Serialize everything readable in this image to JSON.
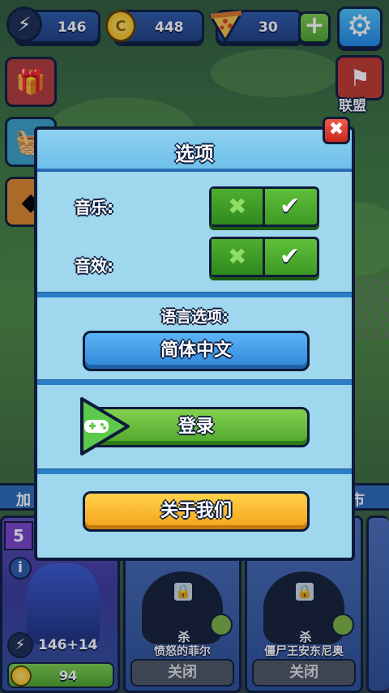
{
  "hud": {
    "energy": "146",
    "coins": "448",
    "pizza": "30",
    "energy_icon": "lightning-icon",
    "coin_icon": "coin-icon",
    "pizza_icon": "pizza-icon",
    "plus_label": "+",
    "settings_icon": "gear-icon"
  },
  "side": {
    "league_label": "联盟"
  },
  "modal": {
    "title": "选项",
    "music_label": "音乐:",
    "sound_label": "音效:",
    "music_on": true,
    "sound_on": true,
    "language_heading": "语言选项:",
    "language_value": "简体中文",
    "login_label": "登录",
    "about_label": "关于我们",
    "close_label": "✖"
  },
  "bottom": {
    "left_tab": "加",
    "right_tab": "市",
    "hero_level": "5",
    "hero_energy": "146+14",
    "hero_cost": "94",
    "cards": [
      {
        "kill_label": "杀",
        "name": "愤怒的菲尔",
        "button": "关闭"
      },
      {
        "kill_label": "杀",
        "name": "僵尸王安东尼奥",
        "button": "关闭"
      }
    ]
  },
  "colors": {
    "panel": "#9fd7ee",
    "outline": "#0d1b3a",
    "blue_button": "#2f86d6",
    "green_button": "#4ea42c",
    "orange_button": "#f4a21a",
    "close_red": "#c9281a"
  }
}
